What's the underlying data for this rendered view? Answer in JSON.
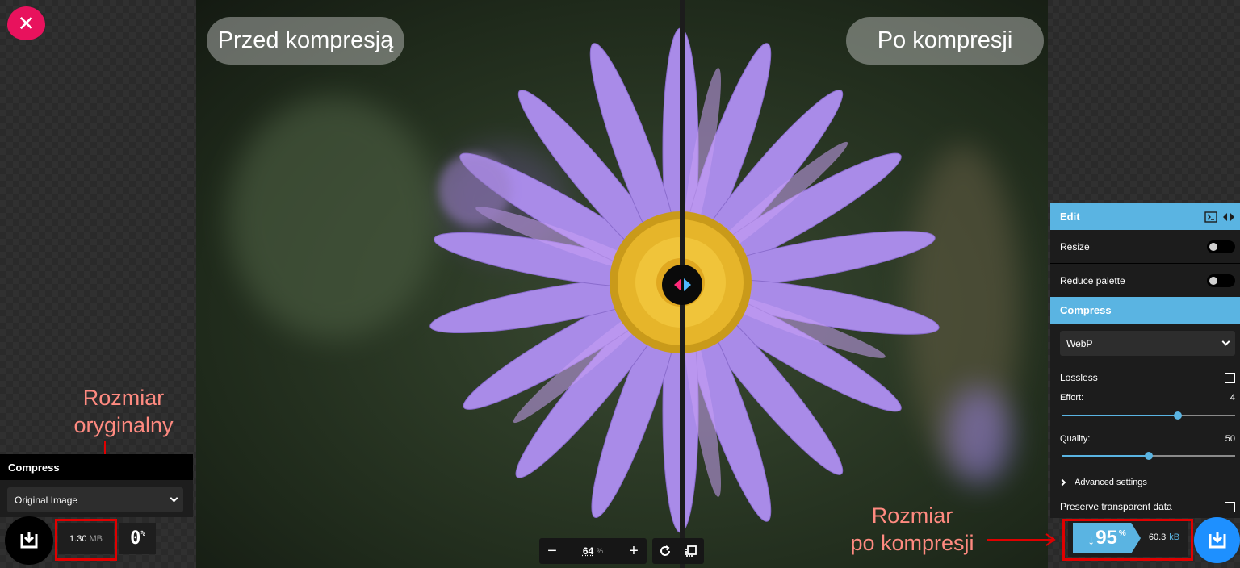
{
  "close_button": {
    "icon": "close-icon",
    "glyph": "✕",
    "color": "#e8125d"
  },
  "photo": {
    "label_before": "Przed kompresją",
    "label_after": "Po kompresji",
    "handle_colors": {
      "left": "#ff2a7a",
      "right": "#4fb6ff"
    }
  },
  "left_panel": {
    "title": "Compress",
    "select_value": "Original Image",
    "size_value": "1.30",
    "size_unit": "MB",
    "percent_value": "0",
    "percent_unit": "%"
  },
  "annotations": {
    "original_size_line1": "Rozmiar",
    "original_size_line2": "oryginalny",
    "compressed_size_line1": "Rozmiar",
    "compressed_size_line2": "po kompresji",
    "color": "#e00000"
  },
  "zoom_bar": {
    "minus": "−",
    "plus": "+",
    "value": "64",
    "unit": "%"
  },
  "right_panel": {
    "edit_title": "Edit",
    "resize_label": "Resize",
    "reduce_palette_label": "Reduce palette",
    "compress_title": "Compress",
    "format_value": "WebP",
    "lossless_label": "Lossless",
    "effort_label": "Effort:",
    "effort_value": "4",
    "effort_fraction": 0.67,
    "quality_label": "Quality:",
    "quality_value": "50",
    "quality_fraction": 0.5,
    "advanced_label": "Advanced settings",
    "preserve_label": "Preserve transparent data",
    "accent": "#5ab4e2"
  },
  "result": {
    "arrow": "↓",
    "percent_value": "95",
    "percent_unit": "%",
    "size_value": "60.3",
    "size_unit": "kB"
  }
}
